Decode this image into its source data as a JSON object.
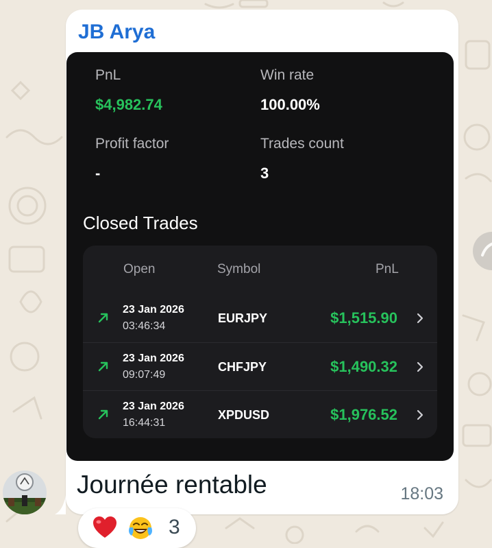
{
  "message": {
    "sender": "JB Arya",
    "text": "Journée rentable",
    "time": "18:03"
  },
  "stats": {
    "pnl_label": "PnL",
    "pnl_value": "$4,982.74",
    "winrate_label": "Win rate",
    "winrate_value": "100.00%",
    "profit_factor_label": "Profit factor",
    "profit_factor_value": "-",
    "trades_count_label": "Trades count",
    "trades_count_value": "3"
  },
  "closed_trades": {
    "title": "Closed Trades",
    "columns": [
      "Open",
      "Symbol",
      "PnL"
    ],
    "rows": [
      {
        "date": "23 Jan 2026",
        "time": "03:46:34",
        "symbol": "EURJPY",
        "pnl": "$1,515.90"
      },
      {
        "date": "23 Jan 2026",
        "time": "09:07:49",
        "symbol": "CHFJPY",
        "pnl": "$1,490.32"
      },
      {
        "date": "23 Jan 2026",
        "time": "16:44:31",
        "symbol": "XPDUSD",
        "pnl": "$1,976.52"
      }
    ]
  },
  "reactions": {
    "emojis": [
      "heart-emoji",
      "laughing-tears-emoji"
    ],
    "count": "3"
  },
  "colors": {
    "sender_blue": "#1f6ed4",
    "profit_green": "#27c25c",
    "card_bg": "#111112",
    "chat_bg": "#efe9df"
  }
}
